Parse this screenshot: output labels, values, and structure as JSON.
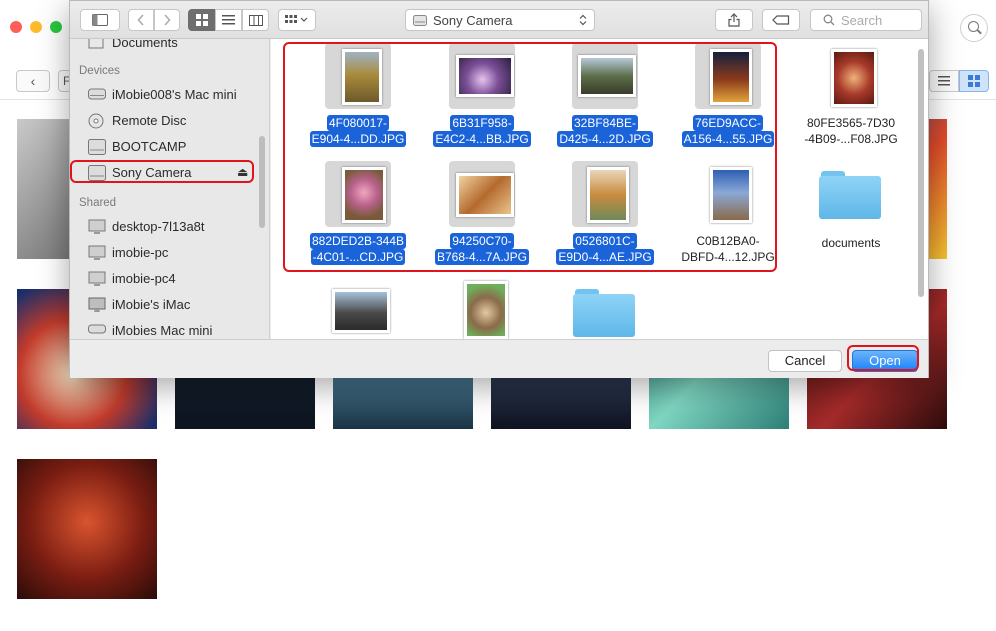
{
  "dialog": {
    "toolbar": {
      "location": "Sony Camera",
      "search_placeholder": "Search"
    },
    "sidebar": {
      "partial_item": "Documents",
      "devices_header": "Devices",
      "devices": [
        {
          "label": "iMobie008's Mac mini",
          "icon": "drive-icon"
        },
        {
          "label": "Remote Disc",
          "icon": "disc-icon"
        },
        {
          "label": "BOOTCAMP",
          "icon": "drive-icon"
        },
        {
          "label": "Sony Camera",
          "icon": "drive-icon",
          "selected": true,
          "eject": "⏏"
        }
      ],
      "shared_header": "Shared",
      "shared": [
        {
          "label": "desktop-7l13a8t",
          "icon": "monitor-icon"
        },
        {
          "label": "imobie-pc",
          "icon": "monitor-icon"
        },
        {
          "label": "imobie-pc4",
          "icon": "monitor-icon"
        },
        {
          "label": "iMobie's iMac",
          "icon": "imac-icon"
        },
        {
          "label": "iMobies Mac mini",
          "icon": "mac-mini-icon"
        }
      ]
    },
    "files": [
      {
        "line1": "4F080017-",
        "line2": "E904-4...DD.JPG",
        "selected": true
      },
      {
        "line1": "6B31F958-",
        "line2": "E4C2-4...BB.JPG",
        "selected": true
      },
      {
        "line1": "32BF84BE-",
        "line2": "D425-4...2D.JPG",
        "selected": true
      },
      {
        "line1": "76ED9ACC-",
        "line2": "A156-4...55.JPG",
        "selected": true
      },
      {
        "line1": "80FE3565-7D30",
        "line2": "-4B09-...F08.JPG",
        "selected": false
      },
      {
        "line1": "882DED2B-344B",
        "line2": "-4C01-...CD.JPG",
        "selected": true
      },
      {
        "line1": "94250C70-",
        "line2": "B768-4...7A.JPG",
        "selected": true
      },
      {
        "line1": "0526801C-",
        "line2": "E9D0-4...AE.JPG",
        "selected": true
      },
      {
        "line1": "C0B12BA0-",
        "line2": "DBFD-4...12.JPG",
        "selected": false
      },
      {
        "line1": "documents",
        "line2": "",
        "selected": false,
        "type": "folder"
      }
    ],
    "buttons": {
      "cancel": "Cancel",
      "open": "Open"
    }
  },
  "background_app": {
    "toolbar_partial_label": "F"
  }
}
